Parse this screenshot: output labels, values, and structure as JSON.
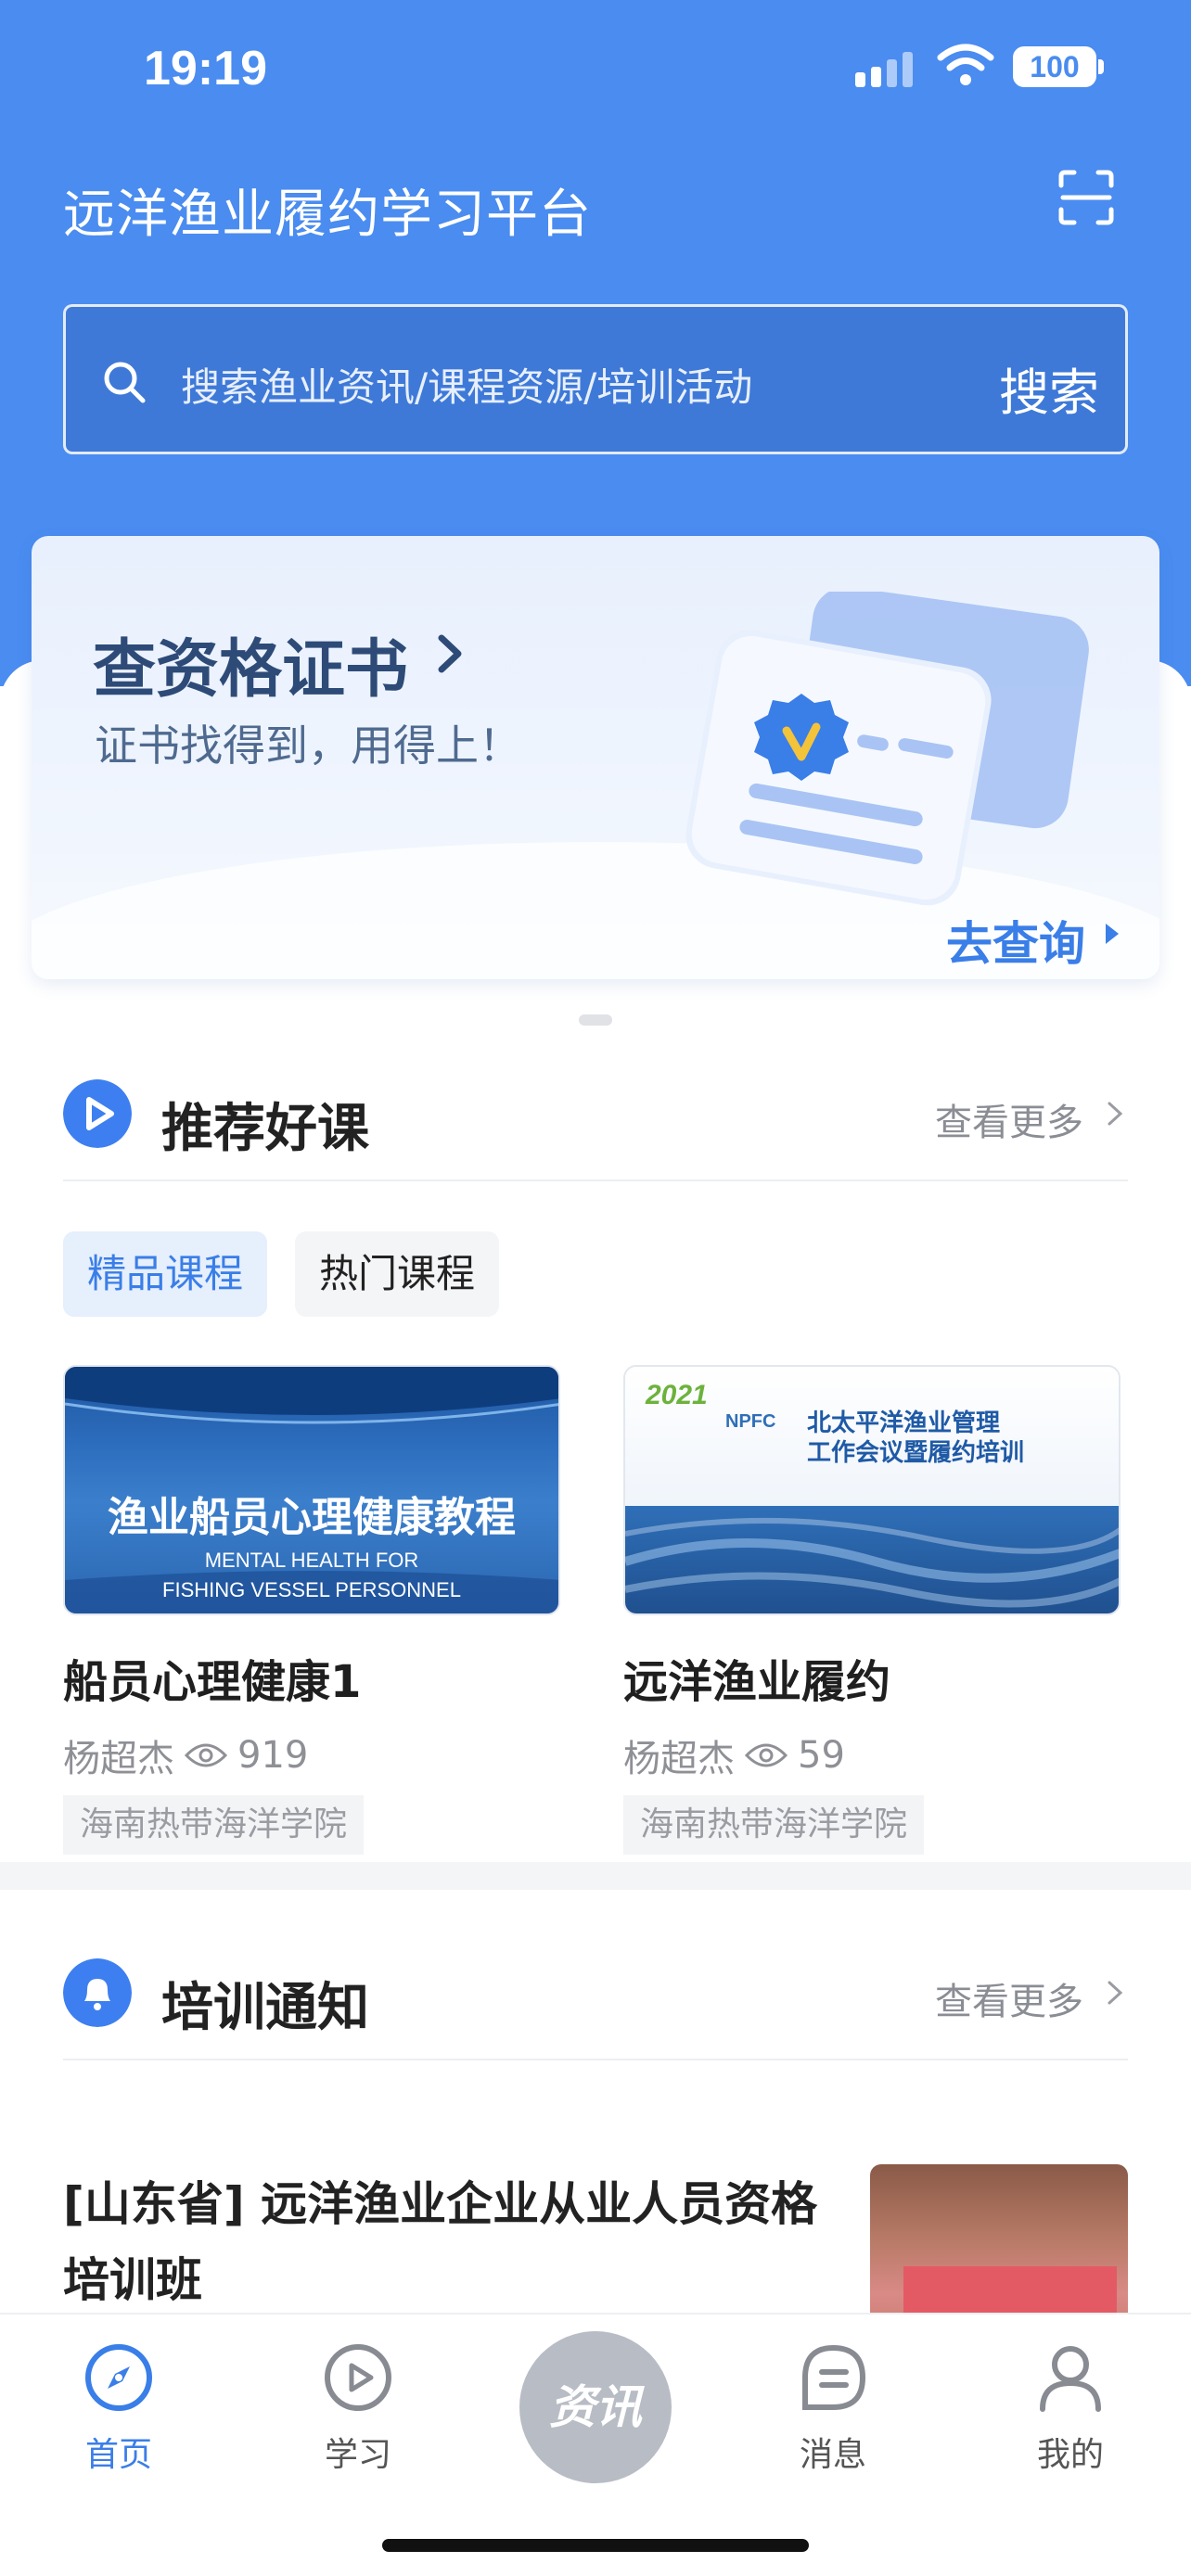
{
  "status": {
    "time": "19:19",
    "battery": "100"
  },
  "header": {
    "title": "远洋渔业履约学习平台",
    "search_placeholder": "搜索渔业资讯/课程资源/培训活动",
    "search_button": "搜索"
  },
  "banner": {
    "title": "查资格证书",
    "subtitle": "证书找得到，用得上！",
    "link": "去查询"
  },
  "recommend": {
    "title": "推荐好课",
    "more": "查看更多",
    "tabs": [
      {
        "label": "精品课程",
        "active": true
      },
      {
        "label": "热门课程",
        "active": false
      }
    ],
    "courses": [
      {
        "title": "船员心理健康1",
        "author": "杨超杰",
        "views": "919",
        "school": "海南热带海洋学院",
        "thumb_title": "渔业船员心理健康教程",
        "thumb_en1": "MENTAL HEALTH FOR",
        "thumb_en2": "FISHING VESSEL PERSONNEL"
      },
      {
        "title": "远洋渔业履约",
        "author": "杨超杰",
        "views": "59",
        "school": "海南热带海洋学院",
        "thumb_year": "2021",
        "thumb_org": "NPFC",
        "thumb_line1": "北太平洋渔业管理",
        "thumb_line2": "工作会议暨履约培训"
      }
    ]
  },
  "training": {
    "title": "培训通知",
    "more": "查看更多",
    "items": [
      {
        "title": "[山东省] 远洋渔业企业从业人员资格培训班"
      }
    ]
  },
  "nav": {
    "items": [
      {
        "label": "首页",
        "icon": "compass-icon",
        "active": true
      },
      {
        "label": "学习",
        "icon": "play-circle-icon",
        "active": false
      },
      {
        "label": "资讯",
        "icon": "news-center-button",
        "active": false
      },
      {
        "label": "消息",
        "icon": "message-icon",
        "active": false
      },
      {
        "label": "我的",
        "icon": "user-icon",
        "active": false
      }
    ]
  },
  "colors": {
    "primary": "#3a7ee8",
    "header": "#4a8cf0"
  }
}
